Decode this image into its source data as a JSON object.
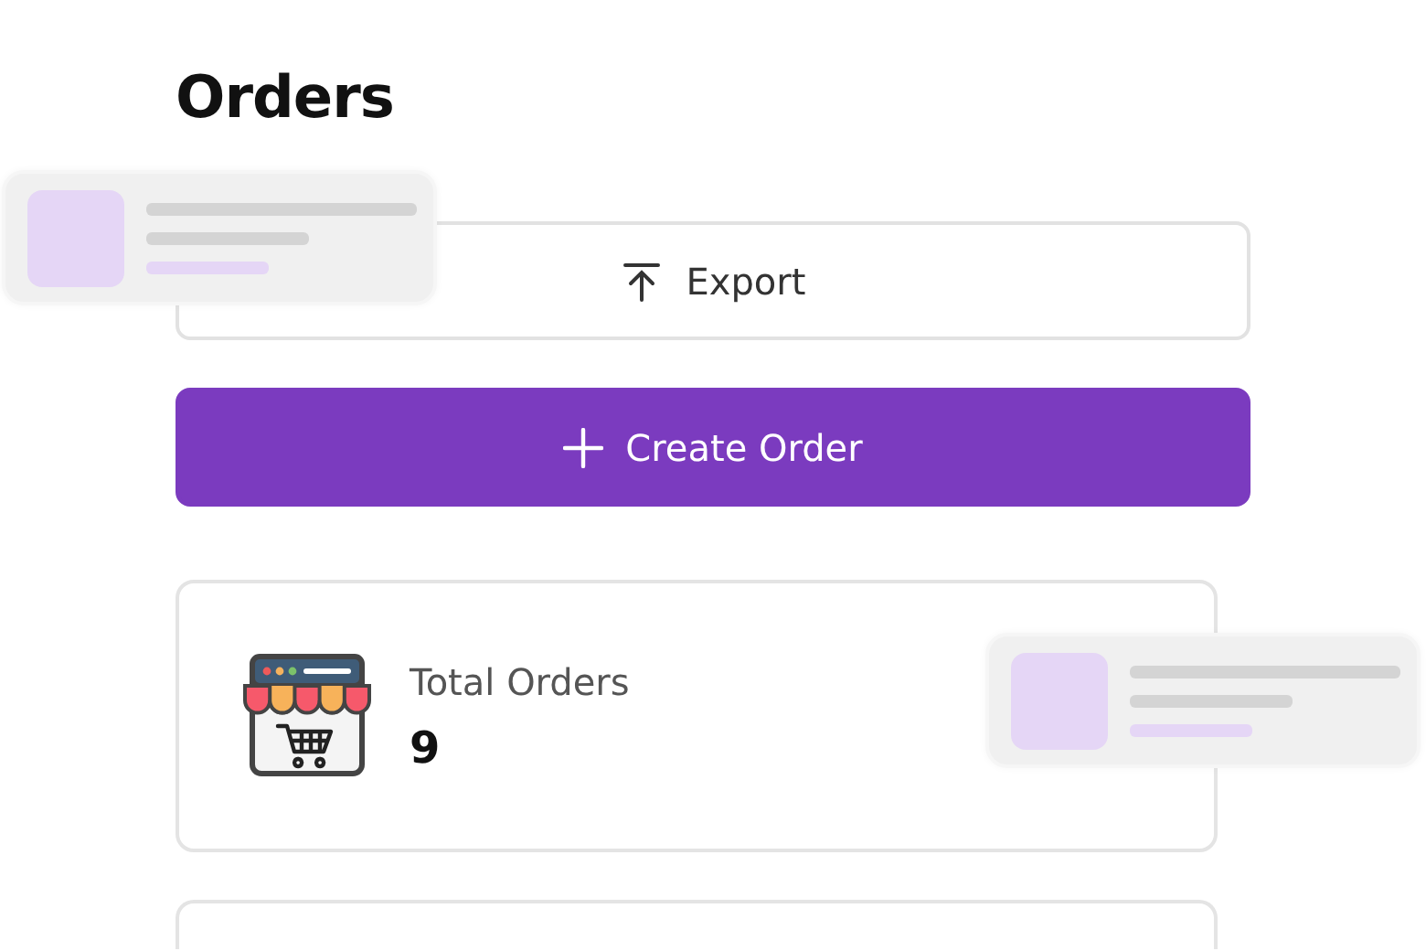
{
  "page": {
    "title": "Orders"
  },
  "actions": [
    {
      "kind": "export",
      "label": "Export"
    },
    {
      "kind": "create",
      "label": "Create Order"
    }
  ],
  "stats": [
    {
      "label": "Total Orders",
      "value": "9"
    }
  ]
}
